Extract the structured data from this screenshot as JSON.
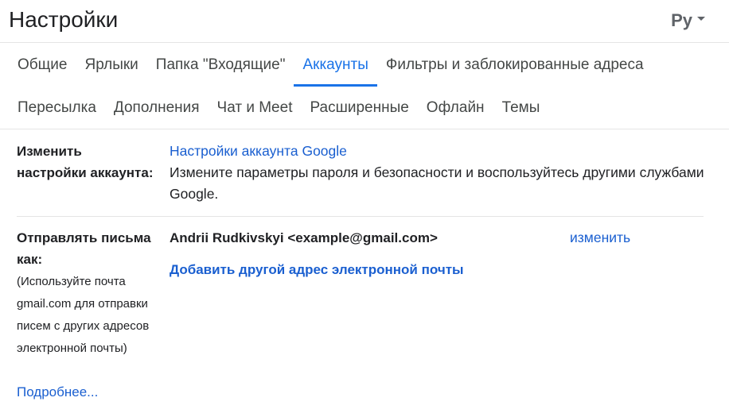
{
  "header": {
    "title": "Настройки",
    "language_icon": "Ру"
  },
  "tabs": {
    "row1": [
      {
        "label": "Общие",
        "active": false
      },
      {
        "label": "Ярлыки",
        "active": false
      },
      {
        "label": "Папка \"Входящие\"",
        "active": false
      },
      {
        "label": "Аккаунты",
        "active": true
      },
      {
        "label": "Фильтры и заблокированные адреса",
        "active": false
      }
    ],
    "row2": [
      {
        "label": "Пересылка",
        "active": false
      },
      {
        "label": "Дополнения",
        "active": false
      },
      {
        "label": "Чат и Meet",
        "active": false
      },
      {
        "label": "Расширенные",
        "active": false
      },
      {
        "label": "Офлайн",
        "active": false
      },
      {
        "label": "Темы",
        "active": false
      }
    ]
  },
  "account_settings": {
    "label_line1": "Изменить",
    "label_line2": "настройки аккаунта:",
    "link": "Настройки аккаунта Google",
    "description": "Измените параметры пароля и безопасности и воспользуйтесь другими службами Google."
  },
  "send_as": {
    "label_line1": "Отправлять письма",
    "label_line2": "как:",
    "hint": "(Используйте почта gmail.com для отправки писем с других адресов электронной почты)",
    "more_link": "Подробнее...",
    "account": "Andrii Rudkivskyi <example@gmail.com>",
    "edit_link": "изменить",
    "add_link": "Добавить другой адрес электронной почты"
  },
  "colors": {
    "accent": "#1a73e8",
    "link": "#1a5fd0",
    "text": "#202124",
    "divider": "#e5e5e5"
  }
}
